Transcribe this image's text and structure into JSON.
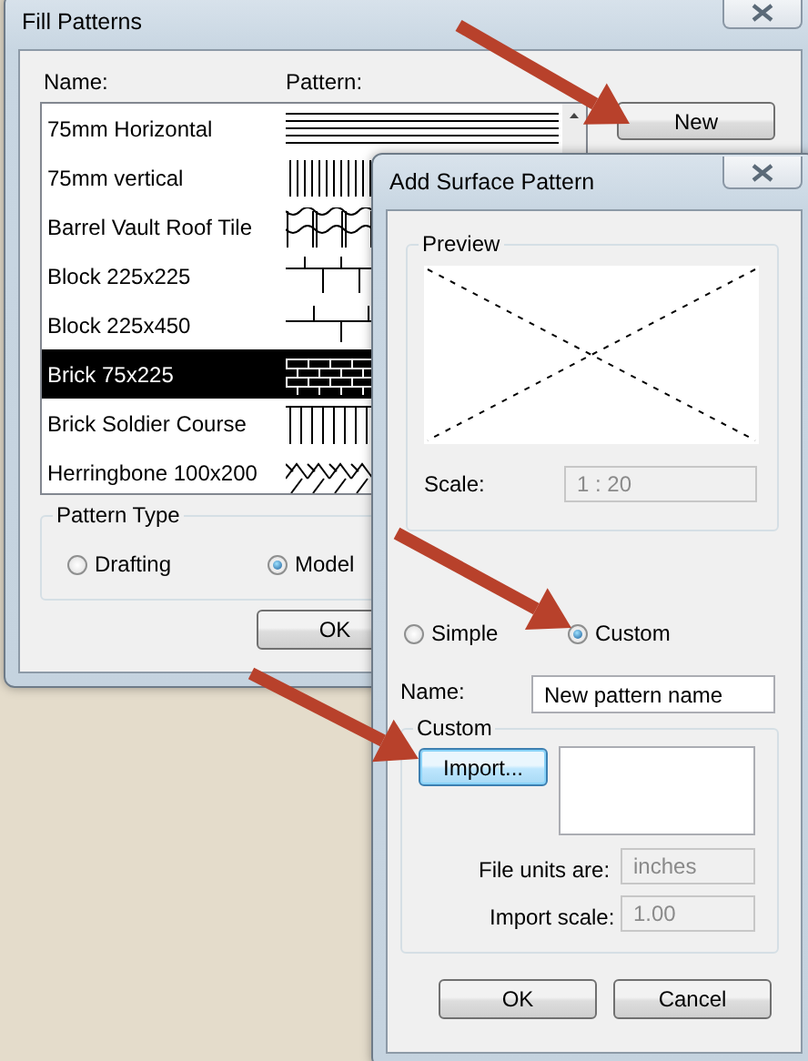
{
  "fill_patterns": {
    "title": "Fill Patterns",
    "name_header": "Name:",
    "pattern_header": "Pattern:",
    "patterns": [
      {
        "name": "75mm Horizontal",
        "kind": "horizontal",
        "selected": false
      },
      {
        "name": "75mm vertical",
        "kind": "vertical",
        "selected": false
      },
      {
        "name": "Barrel Vault Roof Tile",
        "kind": "barrel",
        "selected": false
      },
      {
        "name": "Block 225x225",
        "kind": "block",
        "selected": false
      },
      {
        "name": "Block 225x450",
        "kind": "block_large",
        "selected": false
      },
      {
        "name": "Brick 75x225",
        "kind": "brick",
        "selected": true
      },
      {
        "name": "Brick Soldier Course",
        "kind": "soldier",
        "selected": false
      },
      {
        "name": "Herringbone 100x200",
        "kind": "herringbone",
        "selected": false
      }
    ],
    "new_button": "New",
    "pattern_type": {
      "label": "Pattern Type",
      "options": [
        {
          "label": "Drafting",
          "selected": false
        },
        {
          "label": "Model",
          "selected": true
        }
      ]
    },
    "ok_button": "OK"
  },
  "add_surface_pattern": {
    "title": "Add Surface Pattern",
    "preview_label": "Preview",
    "scale_label": "Scale:",
    "scale_value": "1 : 20",
    "scale_disabled": true,
    "type_options": [
      {
        "label": "Simple",
        "selected": false
      },
      {
        "label": "Custom",
        "selected": true
      }
    ],
    "name_label": "Name:",
    "name_value": "New pattern name",
    "custom_label": "Custom",
    "import_button": "Import...",
    "file_units_label": "File units are:",
    "file_units_value": "inches",
    "file_units_disabled": true,
    "import_scale_label": "Import scale:",
    "import_scale_value": "1.00",
    "import_scale_disabled": true,
    "ok_button": "OK",
    "cancel_button": "Cancel"
  }
}
